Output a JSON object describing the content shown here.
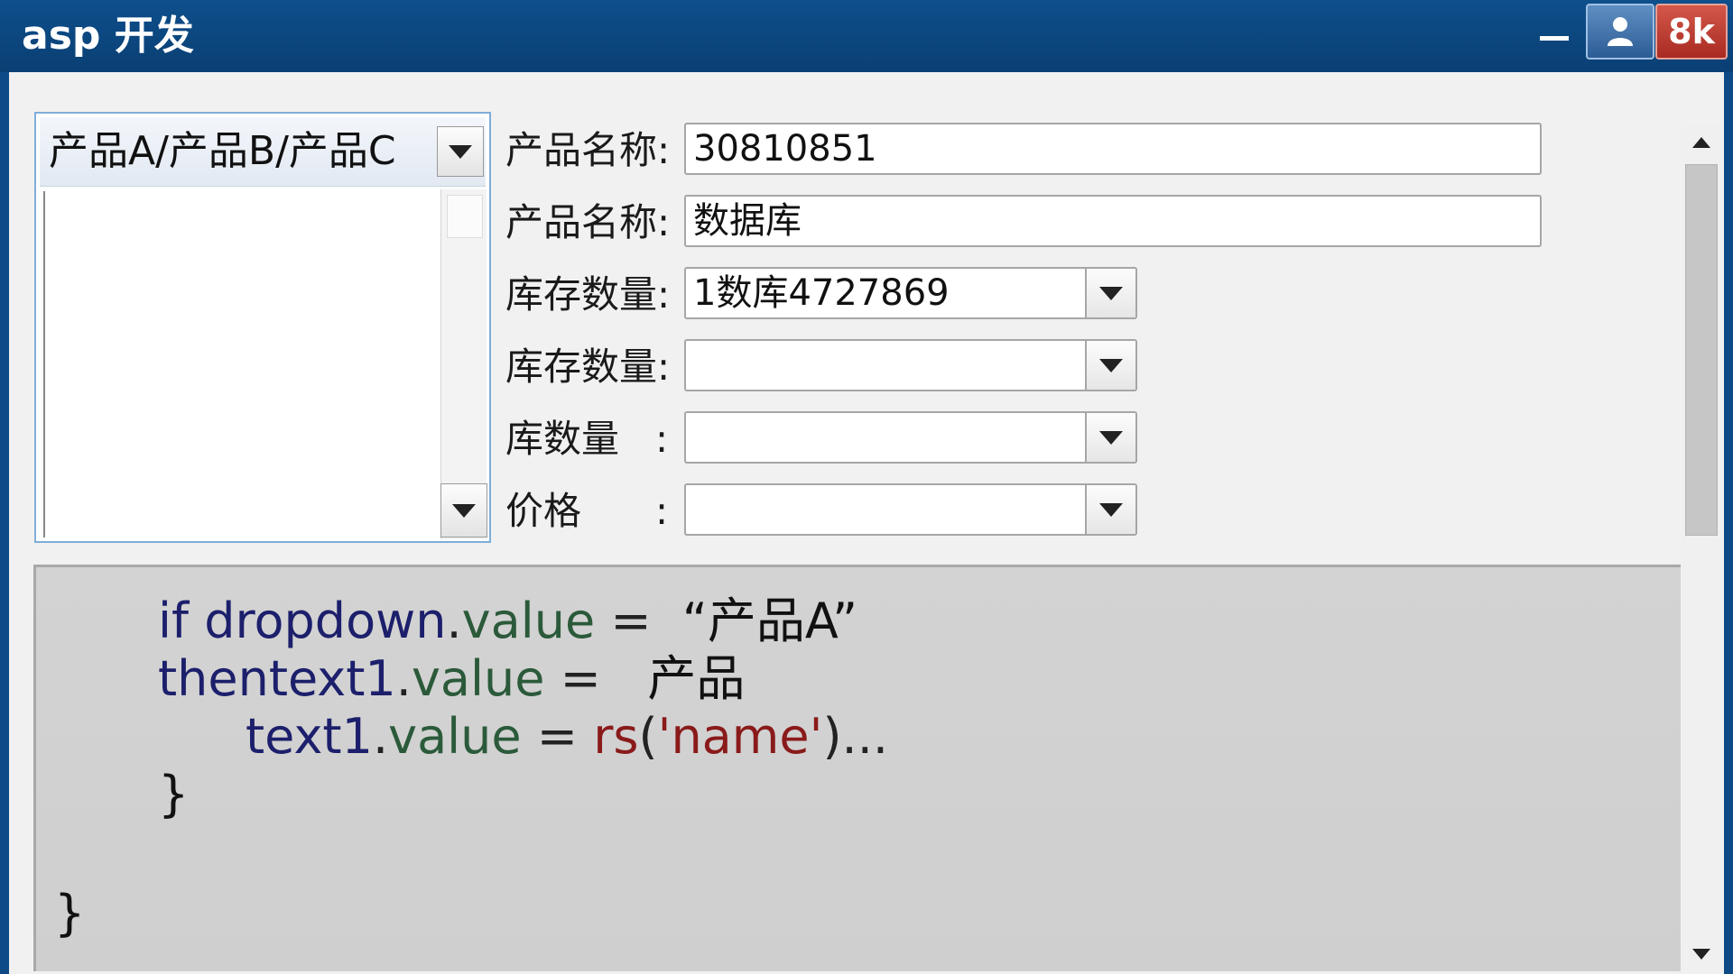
{
  "window": {
    "title": "asp 开发",
    "controls": {
      "min_icon": "minimize-icon",
      "user_icon": "user-icon",
      "quality_label": "8k"
    }
  },
  "list_panel": {
    "header": "产品A/产品B/产品C",
    "items": []
  },
  "form": {
    "rows": [
      {
        "label": "产品名称:",
        "type": "text",
        "value": "30810851"
      },
      {
        "label": "产品名称:",
        "type": "text",
        "value": "数据库"
      },
      {
        "label": "库存数量:",
        "type": "combo",
        "value": "1数库4727869"
      },
      {
        "label": "库存数量:",
        "type": "combo",
        "value": ""
      },
      {
        "label": "库数量",
        "colon": ":",
        "type": "combo",
        "value": ""
      },
      {
        "label": "价格",
        "colon": ":",
        "type": "combo",
        "value": ""
      }
    ]
  },
  "code": {
    "line1": {
      "kw": "if",
      "obj": "dropdown",
      "dot": ".",
      "prop": "value",
      "op": " = ",
      "str": "“产品A”"
    },
    "line2": {
      "kw": "thentext1",
      "dot": ".",
      "prop": "value",
      "op": " =",
      "text": "产品"
    },
    "line3": {
      "obj": "text1",
      "dot": ".",
      "prop": "value",
      "op": " = ",
      "fn": "rs",
      "paren_open": "(",
      "str": "'name'",
      "paren_close": ")",
      "tail": "..."
    },
    "line4": "}",
    "line5": "}"
  }
}
